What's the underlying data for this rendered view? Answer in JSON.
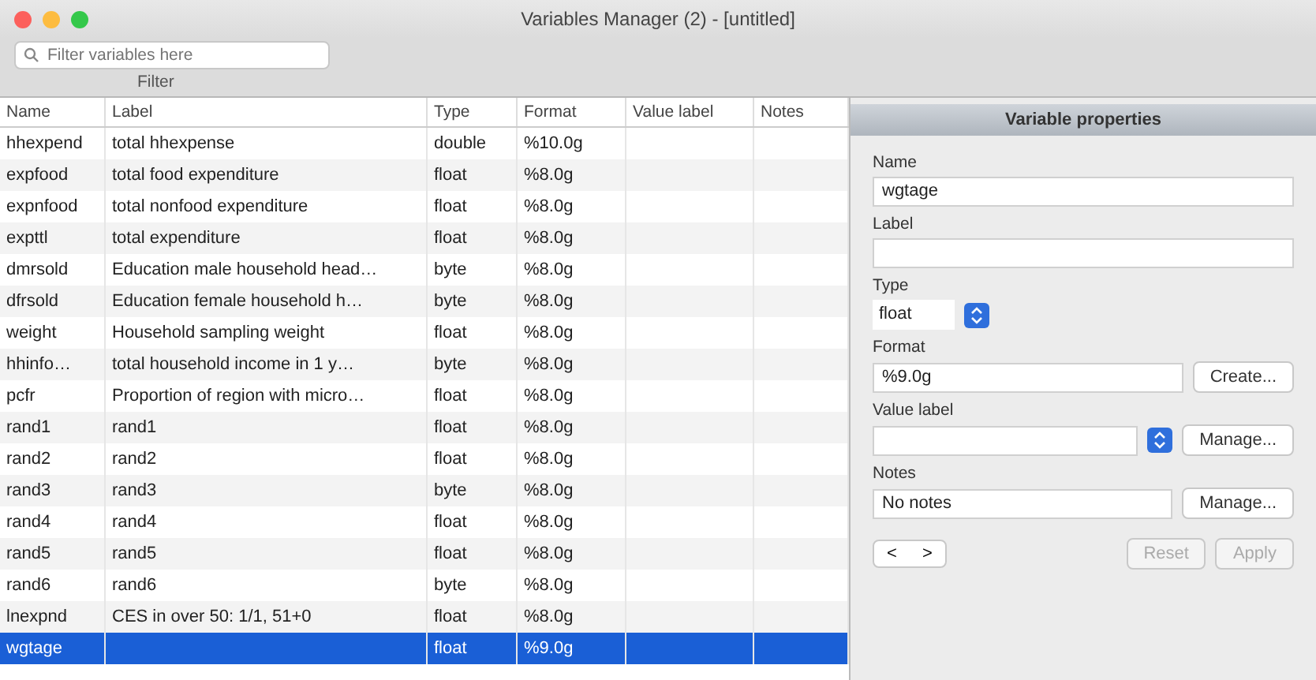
{
  "window": {
    "title": "Variables Manager (2) - [untitled]"
  },
  "filter": {
    "placeholder": "Filter variables here",
    "caption": "Filter"
  },
  "table": {
    "columns": [
      "Name",
      "Label",
      "Type",
      "Format",
      "Value label",
      "Notes"
    ],
    "rows": [
      {
        "name": "hhexpend",
        "label": "total hhexpense",
        "type": "double",
        "format": "%10.0g",
        "selected": false
      },
      {
        "name": "expfood",
        "label": "total food expenditure",
        "type": "float",
        "format": "%8.0g",
        "selected": false
      },
      {
        "name": "expnfood",
        "label": "total nonfood expenditure",
        "type": "float",
        "format": "%8.0g",
        "selected": false
      },
      {
        "name": "expttl",
        "label": "total expenditure",
        "type": "float",
        "format": "%8.0g",
        "selected": false
      },
      {
        "name": "dmrsold",
        "label": "Education male household head…",
        "type": "byte",
        "format": "%8.0g",
        "selected": false
      },
      {
        "name": "dfrsold",
        "label": "Education female household h…",
        "type": "byte",
        "format": "%8.0g",
        "selected": false
      },
      {
        "name": "weight",
        "label": "Household sampling weight",
        "type": "float",
        "format": "%8.0g",
        "selected": false
      },
      {
        "name": "hhinfo…",
        "label": "total household income in 1 y…",
        "type": "byte",
        "format": "%8.0g",
        "selected": false
      },
      {
        "name": "pcfr",
        "label": "Proportion of region with micro…",
        "type": "float",
        "format": "%8.0g",
        "selected": false
      },
      {
        "name": "rand1",
        "label": "rand1",
        "type": "float",
        "format": "%8.0g",
        "selected": false
      },
      {
        "name": "rand2",
        "label": "rand2",
        "type": "float",
        "format": "%8.0g",
        "selected": false
      },
      {
        "name": "rand3",
        "label": "rand3",
        "type": "byte",
        "format": "%8.0g",
        "selected": false
      },
      {
        "name": "rand4",
        "label": "rand4",
        "type": "float",
        "format": "%8.0g",
        "selected": false
      },
      {
        "name": "rand5",
        "label": "rand5",
        "type": "float",
        "format": "%8.0g",
        "selected": false
      },
      {
        "name": "rand6",
        "label": "rand6",
        "type": "byte",
        "format": "%8.0g",
        "selected": false
      },
      {
        "name": "lnexpnd",
        "label": "CES in over 50: 1/1, 51+0",
        "type": "float",
        "format": "%8.0g",
        "selected": false
      },
      {
        "name": "wgtage",
        "label": "",
        "type": "float",
        "format": "%9.0g",
        "selected": true
      }
    ]
  },
  "properties": {
    "title": "Variable properties",
    "name_label": "Name",
    "name_value": "wgtage",
    "label_label": "Label",
    "type_label": "Type",
    "type_value": "float",
    "format_label": "Format",
    "format_value": "%9.0g",
    "create_button": "Create...",
    "value_label_label": "Value label",
    "manage_button": "Manage...",
    "notes_label": "Notes",
    "notes_value": "No notes",
    "notes_button": "Manage...",
    "prev": "<",
    "next": ">",
    "reset_button": "Reset",
    "apply_button": "Apply"
  }
}
